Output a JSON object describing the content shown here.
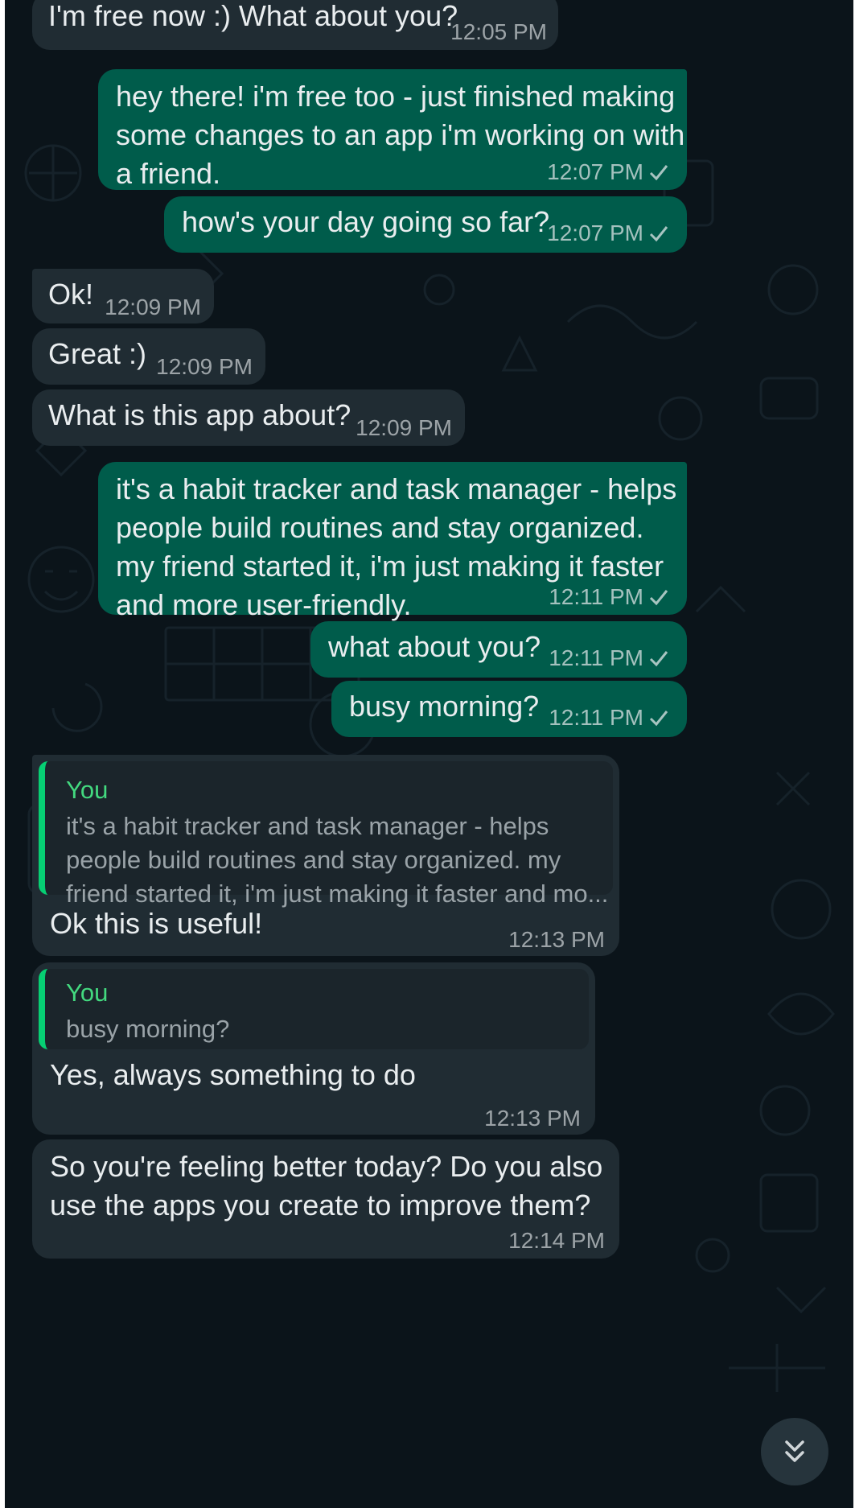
{
  "messages": [
    {
      "dir": "in",
      "text": "I'm free now :) What about you?",
      "time": "12:05 PM"
    },
    {
      "dir": "out",
      "text": "hey there! i'm free too - just finished making\nsome changes to an app i'm working on with\na friend.",
      "time": "12:07 PM"
    },
    {
      "dir": "out",
      "text": "how's your day going so far?",
      "time": "12:07 PM"
    },
    {
      "dir": "in",
      "text": "Ok!",
      "time": "12:09 PM"
    },
    {
      "dir": "in",
      "text": "Great :)",
      "time": "12:09 PM"
    },
    {
      "dir": "in",
      "text": "What is this app about?",
      "time": "12:09 PM"
    },
    {
      "dir": "out",
      "text": "it's a habit tracker and task manager - helps\npeople build routines and stay organized.\nmy friend started it, i'm just making it faster\nand more user-friendly.",
      "time": "12:11 PM"
    },
    {
      "dir": "out",
      "text": "what about you?",
      "time": "12:11 PM"
    },
    {
      "dir": "out",
      "text": "busy morning?",
      "time": "12:11 PM"
    },
    {
      "dir": "in",
      "text": "Ok this is useful!",
      "time": "12:13 PM",
      "quote": {
        "author": "You",
        "text": "it's a habit tracker and task manager - helps\npeople build routines and stay organized. my\nfriend started it, i'm just making it faster and mo..."
      }
    },
    {
      "dir": "in",
      "text": "Yes, always something to do",
      "time": "12:13 PM",
      "quote": {
        "author": "You",
        "text": "busy morning?"
      }
    },
    {
      "dir": "in",
      "text": "So you're feeling better today? Do you also\nuse the apps you create to improve them?",
      "time": "12:14 PM"
    }
  ],
  "colors": {
    "background": "#0b141a",
    "incoming_bubble": "#202c33",
    "outgoing_bubble": "#005c4b",
    "quote_accent": "#06cf73",
    "quote_author": "#43d97f"
  },
  "icons": {
    "read_receipt": "check-icon",
    "scroll_down": "double-chevron-down-icon"
  }
}
